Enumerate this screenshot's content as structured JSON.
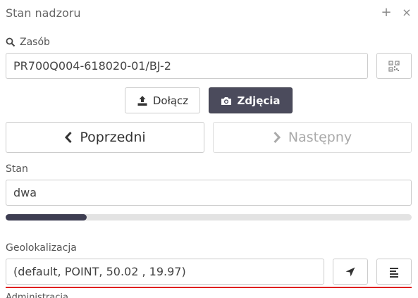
{
  "header": {
    "title": "Stan nadzoru",
    "plus_icon": "+",
    "close_icon": "×"
  },
  "resource": {
    "label": "Zasób",
    "value": "PR700Q004-618020-01/BJ-2"
  },
  "actions": {
    "attach_label": "Dołącz",
    "photos_label": "Zdjęcia"
  },
  "nav": {
    "prev_label": "Poprzedni",
    "next_label": "Następny"
  },
  "state": {
    "label": "Stan",
    "value": "dwa",
    "progress_fraction": 0.2
  },
  "geo": {
    "label": "Geolokalizacja",
    "value": "(default, POINT, 50.02 , 19.97)"
  },
  "next_section": {
    "label": "Administracja"
  },
  "colors": {
    "accent": "#4b4b5c",
    "error_line": "#e02020"
  }
}
